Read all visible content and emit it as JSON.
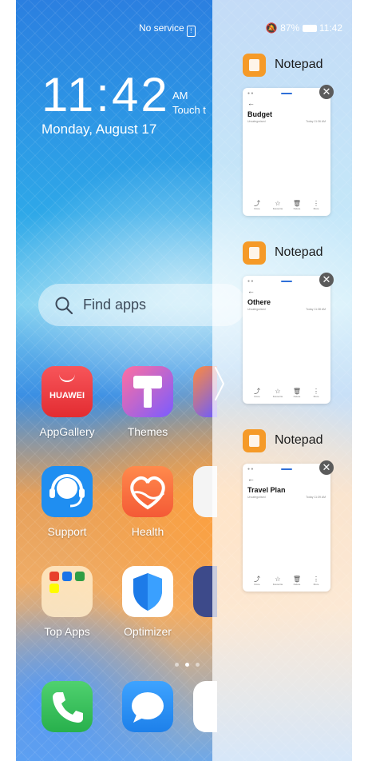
{
  "status_bar": {
    "network": "No service",
    "sim_glyph": "!",
    "battery": "87%",
    "time": "11:42"
  },
  "clock": {
    "time": "11:42",
    "ampm": "AM",
    "touch_hint": "Touch t",
    "date": "Monday, August 17"
  },
  "search": {
    "placeholder": "Find apps"
  },
  "apps": {
    "appgallery": {
      "label": "AppGallery",
      "icon_text": "HUAWEI"
    },
    "themes": {
      "label": "Themes"
    },
    "support": {
      "label": "Support"
    },
    "health": {
      "label": "Health"
    },
    "topapps": {
      "label": "Top Apps"
    },
    "optimizer": {
      "label": "Optimizer"
    }
  },
  "recents": {
    "tasks": [
      {
        "app": "Notepad",
        "title": "Budget",
        "subtitle": "Uncategorised",
        "time": "Today 11:36 AM"
      },
      {
        "app": "Notepad",
        "title": "Othere",
        "subtitle": "Uncategorised",
        "time": "Today 11:38 AM"
      },
      {
        "app": "Notepad",
        "title": "Travel Plan",
        "subtitle": "Uncategorised",
        "time": "Today 11:39 AM"
      }
    ],
    "tools": [
      "Done",
      "Favourite",
      "Delete",
      "More"
    ],
    "close_glyph": "✕"
  },
  "colors": {
    "notepad_orange": "#f59a28",
    "appgallery_red": "#ef3b3f",
    "support_blue": "#1f8ef1",
    "optimizer_blue": "#1d7be8",
    "phone_green": "#36c25a",
    "messages_blue": "#2a8cf0"
  }
}
